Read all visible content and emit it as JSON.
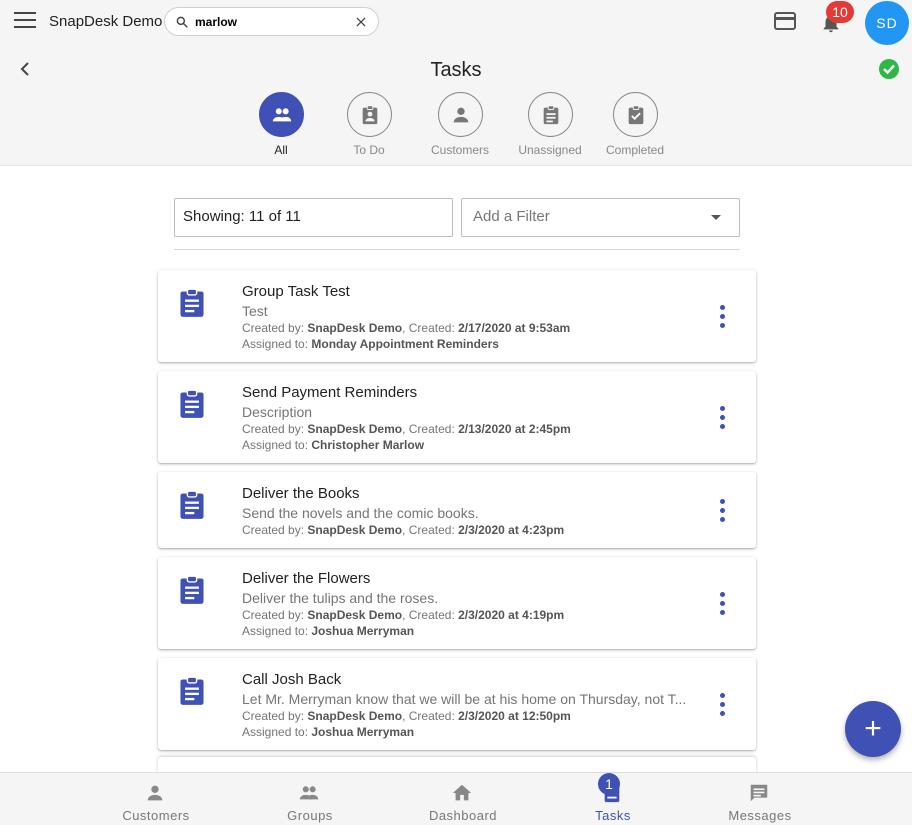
{
  "app": {
    "title": "SnapDesk Demo"
  },
  "search": {
    "value": "marlow",
    "placeholder": ""
  },
  "notifications": {
    "count": "10"
  },
  "user": {
    "initials": "SD"
  },
  "page": {
    "title": "Tasks"
  },
  "tabs": [
    {
      "label": "All",
      "icon": "group-icon",
      "active": true
    },
    {
      "label": "To Do",
      "icon": "assignment-ind-icon",
      "active": false
    },
    {
      "label": "Customers",
      "icon": "person-icon",
      "active": false
    },
    {
      "label": "Unassigned",
      "icon": "assignment-icon",
      "active": false
    },
    {
      "label": "Completed",
      "icon": "assignment-turned-in-icon",
      "active": false
    }
  ],
  "list": {
    "showing": "Showing: 11 of 11",
    "filter_placeholder": "Add a Filter"
  },
  "tasks": [
    {
      "title": "Group Task Test",
      "description": "Test",
      "created_by_label": "Created by: ",
      "created_by": "SnapDesk Demo",
      "created_label": ", Created: ",
      "created": "2/17/2020 at 9:53am",
      "assigned_label": "Assigned to: ",
      "assigned": "Monday Appointment Reminders"
    },
    {
      "title": "Send Payment Reminders",
      "description": "Description",
      "created_by_label": "Created by: ",
      "created_by": "SnapDesk Demo",
      "created_label": ", Created: ",
      "created": "2/13/2020 at 2:45pm",
      "assigned_label": "Assigned to: ",
      "assigned": "Christopher Marlow"
    },
    {
      "title": "Deliver the Books",
      "description": "Send the novels and the comic books.",
      "created_by_label": "Created by: ",
      "created_by": "SnapDesk Demo",
      "created_label": ", Created: ",
      "created": "2/3/2020 at 4:23pm"
    },
    {
      "title": "Deliver the Flowers",
      "description": "Deliver the tulips and the roses.",
      "created_by_label": "Created by: ",
      "created_by": "SnapDesk Demo",
      "created_label": ", Created: ",
      "created": "2/3/2020 at 4:19pm",
      "assigned_label": "Assigned to: ",
      "assigned": "Joshua Merryman"
    },
    {
      "title": "Call Josh Back",
      "description": "Let Mr. Merryman know that we will be at his home on Thursday, not T...",
      "created_by_label": "Created by: ",
      "created_by": "SnapDesk Demo",
      "created_label": ", Created: ",
      "created": "2/3/2020 at 12:50pm",
      "assigned_label": "Assigned to: ",
      "assigned": "Joshua Merryman"
    }
  ],
  "fab": {
    "label": "+"
  },
  "bottom_nav": [
    {
      "label": "Customers",
      "icon": "person-icon"
    },
    {
      "label": "Groups",
      "icon": "group-icon"
    },
    {
      "label": "Dashboard",
      "icon": "home-icon"
    },
    {
      "label": "Tasks",
      "icon": "assignment-icon",
      "active": true,
      "badge": "1"
    },
    {
      "label": "Messages",
      "icon": "message-icon"
    }
  ],
  "colors": {
    "primary": "#3f51b5",
    "badge_red": "#e53935",
    "avatar_blue": "#2196f3",
    "success_green": "#2db843"
  }
}
